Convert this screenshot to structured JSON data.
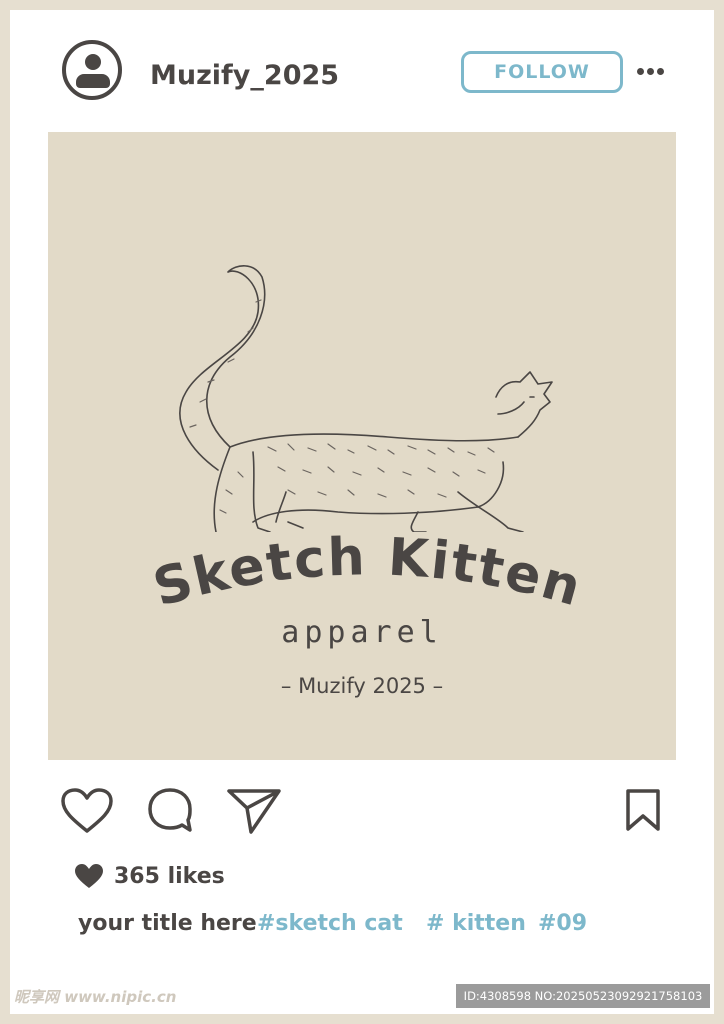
{
  "header": {
    "username": "Muzify_2025",
    "follow_label": "FOLLOW",
    "more_icon": "more-horizontal-icon",
    "avatar_icon": "user-avatar-icon"
  },
  "post_image": {
    "brand_title": "Sketch Kitten",
    "brand_subtitle": "apparel",
    "brand_signature": "– Muzify 2025 –",
    "background_color": "#e2dac8"
  },
  "actions": {
    "like_icon": "heart-outline-icon",
    "comment_icon": "comment-bubble-icon",
    "share_icon": "send-paper-plane-icon",
    "save_icon": "bookmark-icon"
  },
  "likes": {
    "text": "365 likes"
  },
  "caption": {
    "title": "your title here",
    "tags": [
      "#sketch cat",
      "# kitten",
      "#09"
    ]
  },
  "watermark": {
    "left": "昵享网 www.nipic.cn",
    "right": "ID:4308598 NO:20250523092921758103"
  },
  "colors": {
    "frame": "#e6dfd0",
    "text": "#4a4644",
    "accent": "#7db8cb"
  }
}
